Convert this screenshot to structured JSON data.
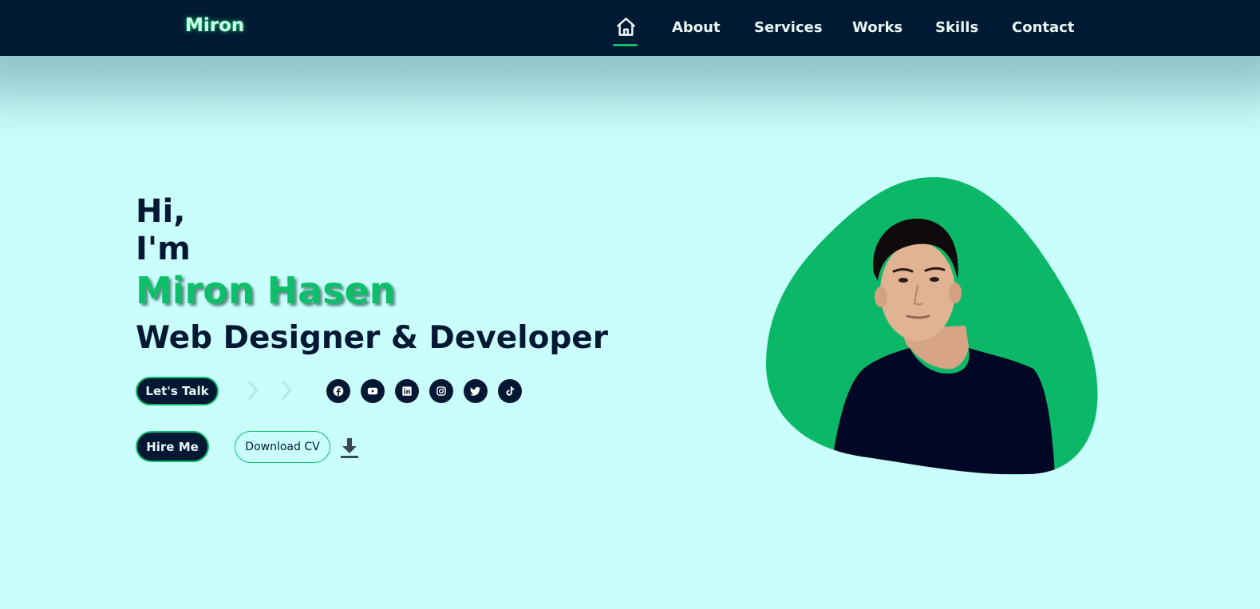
{
  "nav": {
    "logo": "Miron",
    "home_icon": "home-icon",
    "links": [
      "About",
      "Services",
      "Works",
      "Skills",
      "Contact"
    ]
  },
  "hero": {
    "greeting": "Hi,",
    "intro": "I'm",
    "name": "Miron Hasen",
    "role": "Web Designer & Developer",
    "lets_talk": "Let's Talk",
    "hire_me": "Hire Me",
    "download_cv": "Download CV"
  },
  "social": [
    "facebook-icon",
    "youtube-icon",
    "linkedin-icon",
    "instagram-icon",
    "twitter-icon",
    "tiktok-icon"
  ],
  "colors": {
    "navbar_bg": "#011a33",
    "page_bg": "#c9fefd",
    "accent_green": "#0dbf6a",
    "dark_text": "#051833"
  }
}
